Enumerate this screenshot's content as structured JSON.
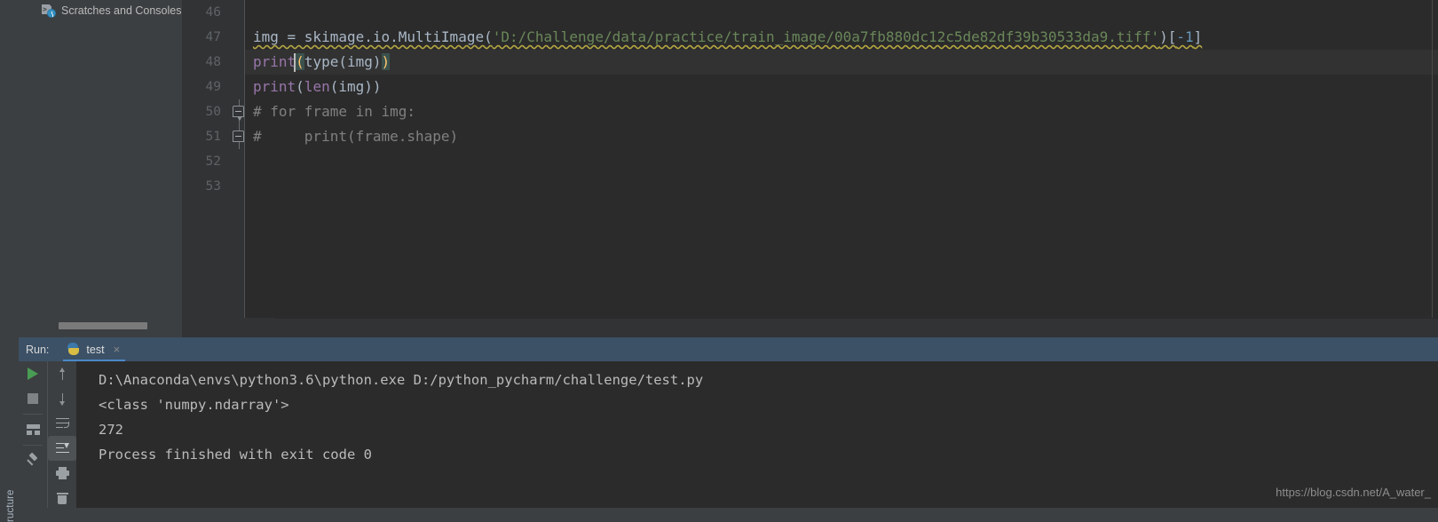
{
  "tool_strip": {
    "structure_label": "ructure"
  },
  "project_panel": {
    "items": [
      {
        "label": "Scratches and Consoles",
        "icon": "console-clock-icon"
      }
    ]
  },
  "editor": {
    "lines": [
      {
        "number": "46",
        "fold": "none",
        "current": false
      },
      {
        "number": "47",
        "fold": "none",
        "current": false
      },
      {
        "number": "48",
        "fold": "none",
        "current": true
      },
      {
        "number": "49",
        "fold": "none",
        "current": false
      },
      {
        "number": "50",
        "fold": "start",
        "current": false
      },
      {
        "number": "51",
        "fold": "end",
        "current": false
      },
      {
        "number": "52",
        "fold": "none",
        "current": false
      },
      {
        "number": "53",
        "fold": "none",
        "current": false
      }
    ],
    "code": {
      "l46": "",
      "l47_a": "img = skimage.io.MultiImage(",
      "l47_str": "'D:/Challenge/data/practice/train_image/00a7fb880dc12c5de82df39b30533da9.tiff'",
      "l47_b": ")[",
      "l47_num": "-1",
      "l47_c": "]",
      "l48_fn": "print",
      "l48_p1": "(",
      "l48_inner": "type(img)",
      "l48_p2": ")",
      "l49_fn": "print",
      "l49_rest_open": "(",
      "l49_inner": "len",
      "l49_rest": "(img))",
      "l50": "# for frame in img:",
      "l51": "#     print(frame.shape)",
      "l52": "",
      "l53": ""
    }
  },
  "run_window": {
    "label": "Run:",
    "tab": {
      "title": "test",
      "icon": "python-icon",
      "close": "×"
    },
    "toolbar_left": [
      {
        "name": "rerun-button",
        "icon": "run-icon"
      },
      {
        "name": "stop-button",
        "icon": "stop-icon"
      },
      {
        "name": "layout-button",
        "icon": "layout-icon"
      },
      {
        "name": "pin-button",
        "icon": "pin-icon"
      }
    ],
    "toolbar_right": [
      {
        "name": "prev-occurrence-button",
        "icon": "arrow-up-icon"
      },
      {
        "name": "next-occurrence-button",
        "icon": "arrow-down-icon"
      },
      {
        "name": "soft-wrap-button",
        "icon": "soft-wrap-icon"
      },
      {
        "name": "scroll-to-end-button",
        "icon": "scroll-to-end-icon"
      },
      {
        "name": "print-button",
        "icon": "print-icon"
      },
      {
        "name": "clear-all-button",
        "icon": "trash-icon"
      }
    ],
    "output": [
      "D:\\Anaconda\\envs\\python3.6\\python.exe D:/python_pycharm/challenge/test.py",
      "<class 'numpy.ndarray'>",
      "272",
      "",
      "Process finished with exit code 0"
    ]
  },
  "watermark": "https://blog.csdn.net/A_water_",
  "colors": {
    "editor_bg": "#2b2b2b",
    "panel_bg": "#3c3f41",
    "gutter_bg": "#313335",
    "string": "#6a8759",
    "number": "#6897bb",
    "function": "#9876aa",
    "comment": "#808080",
    "default_text": "#a9b7c6",
    "run_header": "#3c5166",
    "tab_underline": "#4a88c7",
    "run_green": "#499c54"
  }
}
